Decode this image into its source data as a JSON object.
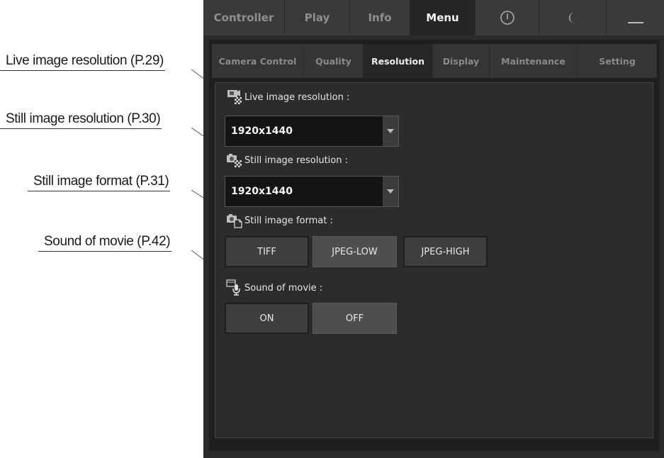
{
  "callouts": [
    {
      "text": "Live image resolution (P.29)"
    },
    {
      "text": "Still image resolution (P.30)"
    },
    {
      "text": "Still image format (P.31)"
    },
    {
      "text": "Sound of movie (P.42)"
    }
  ],
  "top_tabs": [
    {
      "label": "Controller"
    },
    {
      "label": "Play"
    },
    {
      "label": "Info"
    },
    {
      "label": "Menu",
      "active": true
    },
    {
      "icon": "power-icon"
    },
    {
      "icon": "moon-icon"
    },
    {
      "icon": "minimize-icon"
    }
  ],
  "sub_tabs": [
    {
      "label": "Camera Control"
    },
    {
      "label": "Quality"
    },
    {
      "label": "Resolution",
      "active": true
    },
    {
      "label": "Display"
    },
    {
      "label": "Maintenance"
    },
    {
      "label": "Setting"
    }
  ],
  "live_resolution": {
    "label": "Live image resolution :",
    "icon": "live-resolution-icon",
    "value": "1920x1440"
  },
  "still_resolution": {
    "label": "Still image resolution :",
    "icon": "still-resolution-icon",
    "value": "1920x1440"
  },
  "still_format": {
    "label": "Still image format :",
    "icon": "still-format-icon",
    "options": [
      {
        "label": "TIFF",
        "selected": true
      },
      {
        "label": "JPEG-LOW",
        "selected": false
      },
      {
        "label": "JPEG-HIGH",
        "selected": true
      }
    ]
  },
  "sound_of_movie": {
    "label": "Sound of movie :",
    "icon": "sound-of-movie-icon",
    "options": [
      {
        "label": "ON",
        "selected": true
      },
      {
        "label": "OFF",
        "selected": false
      }
    ]
  },
  "colors": {
    "panel_bg": "#2c2c2c",
    "active_tab": "#252525",
    "button_normal": "#4e4e4e",
    "button_selected": "#3e3e3e"
  }
}
